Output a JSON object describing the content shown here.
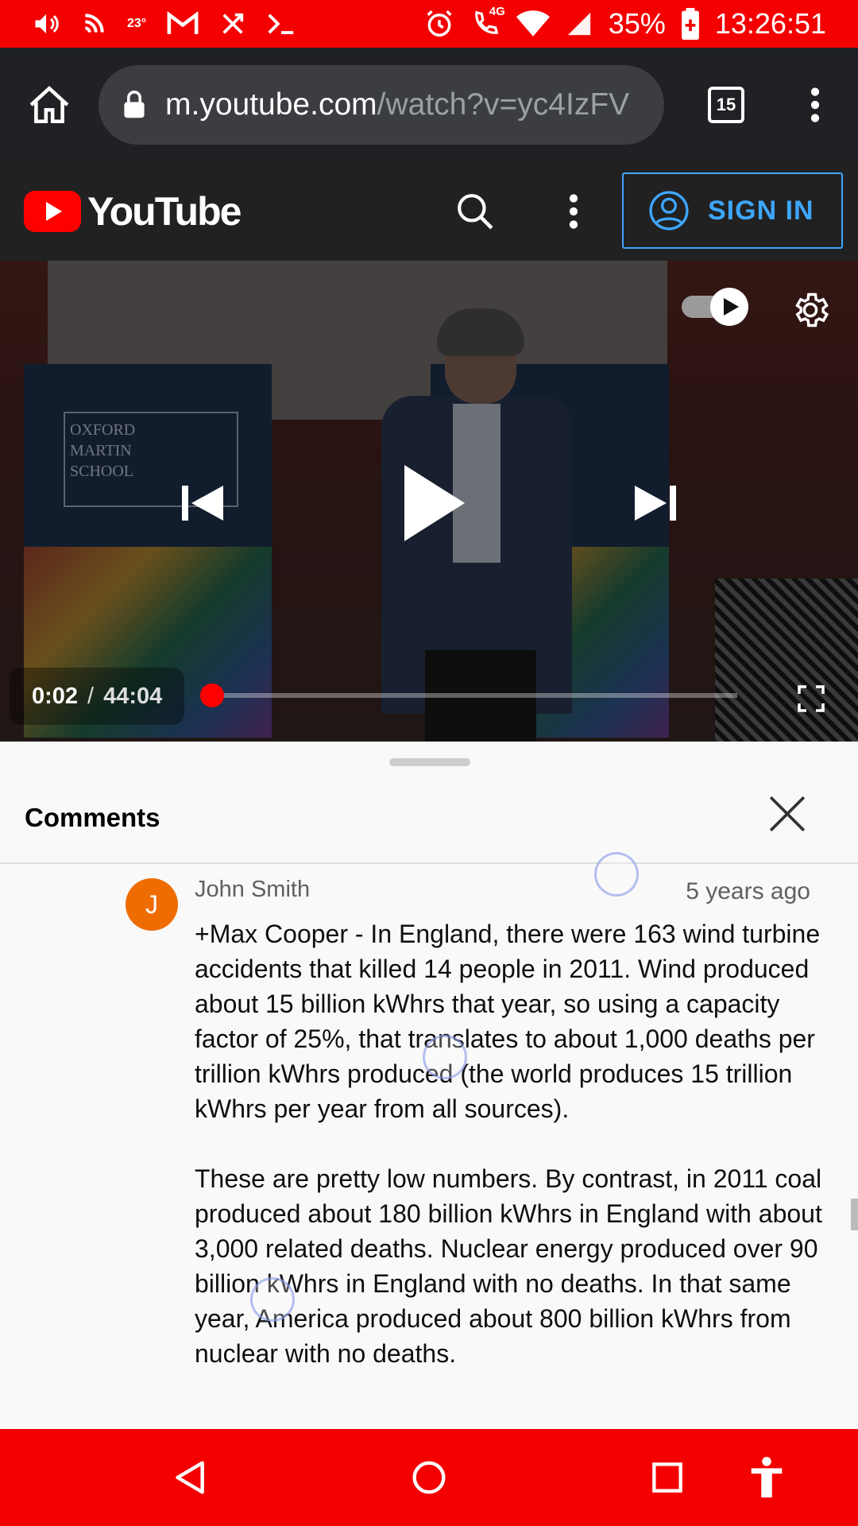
{
  "status_bar": {
    "temperature": "23°",
    "network_type": "4G",
    "battery_percent": "35%",
    "time": "13:26:51"
  },
  "browser": {
    "url_host": "m.youtube.com",
    "url_path": "/watch?v=yc4IzFV",
    "tab_count": "15"
  },
  "youtube_header": {
    "logo_text": "YouTube",
    "sign_in_label": "SIGN IN"
  },
  "player": {
    "current_time": "0:02",
    "separator": "/",
    "duration": "44:04",
    "progress_fraction": 0.001,
    "banner_text": "OXFORD MARTIN SCHOOL",
    "autoplay_on": true
  },
  "comments_panel": {
    "title": "Comments",
    "comments": [
      {
        "avatar_letter": "J",
        "author": "John Smith",
        "timestamp": "5 years ago",
        "paragraphs": [
          "+Max Cooper - In England, there were 163 wind turbine accidents that killed 14 people in 2011. Wind produced about 15 billion kWhrs that year, so using a capacity factor of 25%, that translates to about 1,000 deaths per trillion kWhrs produced (the world produces 15 trillion kWhrs per year from all sources).",
          "These are pretty low numbers. By contrast, in 2011 coal produced about 180 billion kWhrs in England with about 3,000 related deaths. Nuclear energy produced over 90 billion kWhrs in England with no deaths. In that same year, America produced about 800 billion kWhrs from nuclear with no deaths."
        ]
      }
    ]
  },
  "colors": {
    "status_bar": "#f40000",
    "browser_bar": "#202124",
    "youtube_header": "#212121",
    "accent_blue": "#3ea6ff",
    "progress_red": "#ff0000",
    "avatar_orange": "#ef6c00"
  },
  "icons": {
    "status": [
      "volume-icon",
      "cast-icon",
      "weather-icon",
      "gmail-icon",
      "missed-call-icon",
      "terminal-icon",
      "alarm-icon",
      "wifi-calling-icon",
      "wifi-icon",
      "signal-icon",
      "battery-icon"
    ],
    "nav": [
      "back-icon",
      "home-icon",
      "recents-icon",
      "accessibility-icon"
    ]
  }
}
